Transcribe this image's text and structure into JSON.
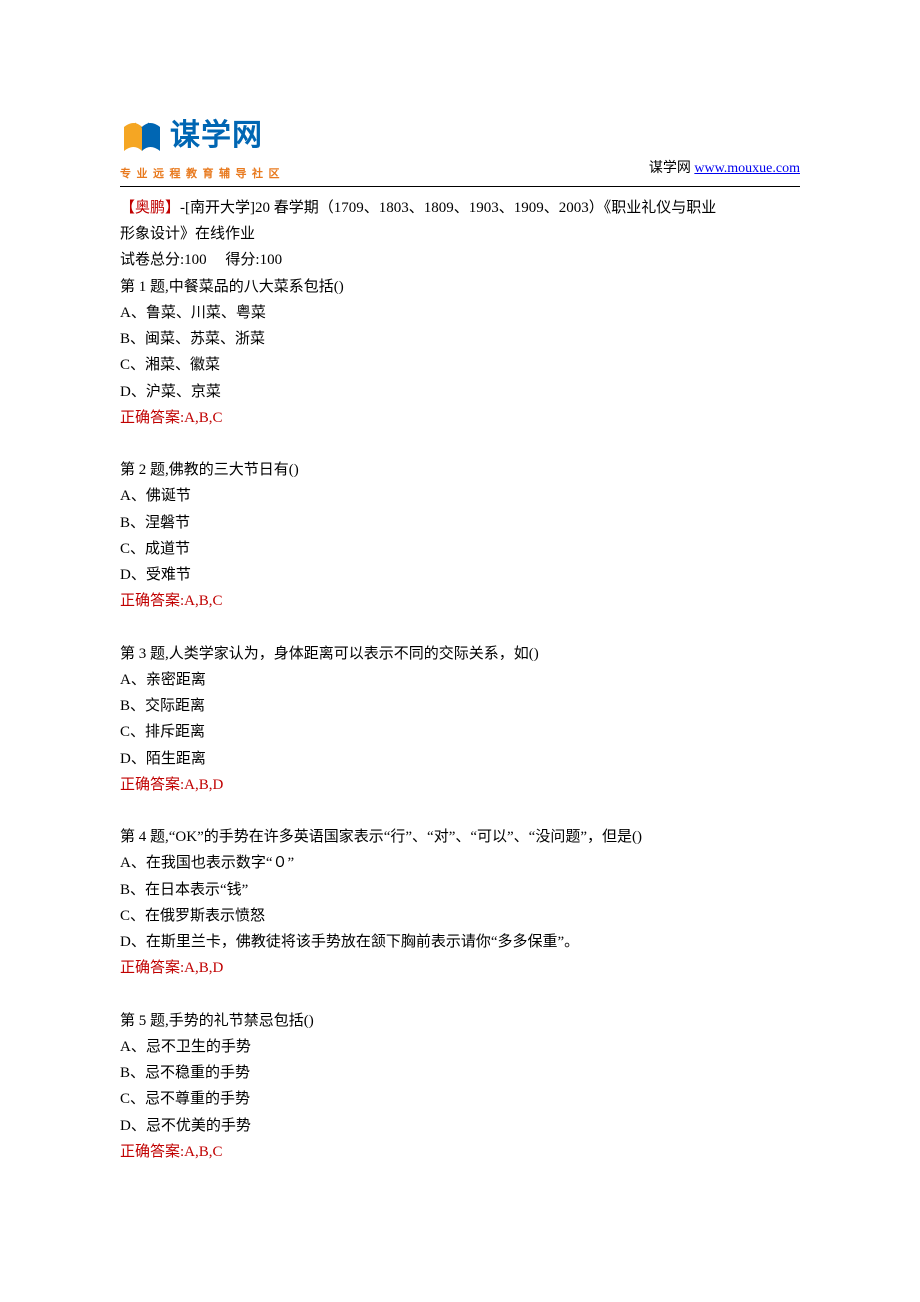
{
  "header": {
    "brand_main": "谋学网",
    "tagline": "专业远程教育辅导社区",
    "label": "谋学网",
    "url": "www.mouxue.com"
  },
  "intro": {
    "title_line1_red": "【奥鹏】",
    "title_line1_rest": "-[南开大学]20 春学期（1709、1803、1809、1903、1909、2003）《职业礼仪与职业",
    "title_line2": "形象设计》在线作业",
    "score_line": "试卷总分:100     得分:100"
  },
  "questions": [
    {
      "q": "第 1 题,中餐菜品的八大菜系包括()",
      "opts": [
        "A、鲁菜、川菜、粤菜",
        "B、闽菜、苏菜、浙菜",
        "C、湘菜、徽菜",
        "D、沪菜、京菜"
      ],
      "ans": "正确答案:A,B,C"
    },
    {
      "q": "第 2 题,佛教的三大节日有()",
      "opts": [
        "A、佛诞节",
        "B、涅磐节",
        "C、成道节",
        "D、受难节"
      ],
      "ans": "正确答案:A,B,C"
    },
    {
      "q": "第 3 题,人类学家认为，身体距离可以表示不同的交际关系，如()",
      "opts": [
        "A、亲密距离",
        "B、交际距离",
        "C、排斥距离",
        "D、陌生距离"
      ],
      "ans": "正确答案:A,B,D"
    },
    {
      "q": "第 4 题,“OK”的手势在许多英语国家表示“行”、“对”、“可以”、“没问题”，但是()",
      "opts": [
        "A、在我国也表示数字“０”",
        "B、在日本表示“钱”",
        "C、在俄罗斯表示愤怒",
        "D、在斯里兰卡，佛教徒将该手势放在颔下胸前表示请你“多多保重”。"
      ],
      "ans": "正确答案:A,B,D"
    },
    {
      "q": "第 5 题,手势的礼节禁忌包括()",
      "opts": [
        "A、忌不卫生的手势",
        "B、忌不稳重的手势",
        "C、忌不尊重的手势",
        "D、忌不优美的手势"
      ],
      "ans": "正确答案:A,B,C"
    }
  ]
}
